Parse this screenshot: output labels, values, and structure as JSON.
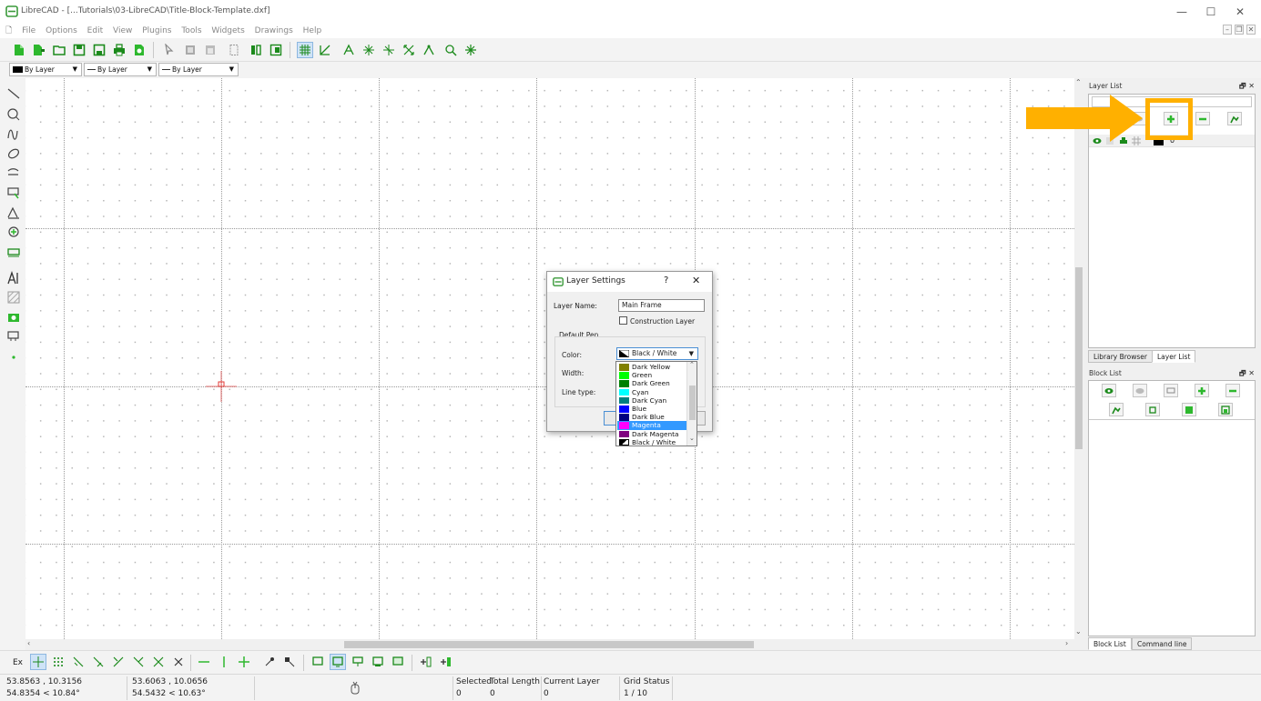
{
  "window": {
    "title": "LibreCAD - [...Tutorials\\03-LibreCAD\\Title-Block-Template.dxf]",
    "minimize": "—",
    "maximize": "☐",
    "close": "✕"
  },
  "menubar": {
    "items": [
      "File",
      "Options",
      "Edit",
      "View",
      "Plugins",
      "Tools",
      "Widgets",
      "Drawings",
      "Help"
    ],
    "mdi_min": "–",
    "mdi_restore": "❐",
    "mdi_close": "✕"
  },
  "pen_toolbar": {
    "color": "By Layer",
    "width": "By Layer",
    "linetype": "By Layer"
  },
  "layer_list": {
    "title": "Layer List",
    "layers": [
      {
        "name": "0"
      }
    ]
  },
  "dock_tabs": {
    "library_browser": "Library Browser",
    "layer_list": "Layer List"
  },
  "block_list": {
    "title": "Block List"
  },
  "bottom_tabs": {
    "block_list": "Block List",
    "command_line": "Command line"
  },
  "dock_controls": "🗗 ✕",
  "cmdbar": {
    "ex_label": "Ex"
  },
  "status": {
    "abs_coord": "53.8563 , 10.3156",
    "abs_polar": "54.8354 < 10.84°",
    "rel_coord": "53.6063 , 10.0656",
    "rel_polar": "54.5432 < 10.63°",
    "selected_label": "Selected",
    "selected_value": "0",
    "total_length_label": "Total Length",
    "total_length_value": "0",
    "current_layer_label": "Current Layer",
    "current_layer_value": "0",
    "grid_status_label": "Grid Status",
    "grid_status_value": "1 / 10"
  },
  "dialog": {
    "title": "Layer Settings",
    "help": "?",
    "close": "✕",
    "layer_name_label": "Layer Name:",
    "layer_name_value": "Main Frame",
    "construction_label": "Construction Layer",
    "default_pen_label": "Default Pen",
    "color_label": "Color:",
    "color_value": "Black / White",
    "width_label": "Width:",
    "linetype_label": "Line type:"
  },
  "color_options": [
    {
      "label": "Dark Yellow",
      "color": "#808000"
    },
    {
      "label": "Green",
      "color": "#00ff00"
    },
    {
      "label": "Dark Green",
      "color": "#008000"
    },
    {
      "label": "Cyan",
      "color": "#00ffff"
    },
    {
      "label": "Dark Cyan",
      "color": "#008080"
    },
    {
      "label": "Blue",
      "color": "#0000ff"
    },
    {
      "label": "Dark Blue",
      "color": "#000080"
    },
    {
      "label": "Magenta",
      "color": "#ff00ff"
    },
    {
      "label": "Dark Magenta",
      "color": "#800080"
    },
    {
      "label": "Black / White",
      "color": "#000000"
    }
  ],
  "selected_option": "Magenta",
  "colors": {
    "accent_green": "#2eb82e",
    "annotation": "#ffb000",
    "crosshair": "#e53935"
  }
}
